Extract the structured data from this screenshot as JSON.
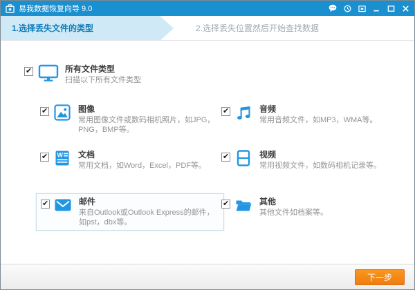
{
  "window": {
    "title": "易我数据恢复向导 9.0",
    "titlebar_icons": [
      "chat",
      "history",
      "window",
      "minimize",
      "maximize",
      "close"
    ]
  },
  "steps": [
    {
      "label": "1.选择丢失文件的类型",
      "active": true
    },
    {
      "label": "2.选择丢失位置然后开始查找数据",
      "active": false
    }
  ],
  "all_types": {
    "title": "所有文件类型",
    "desc": "扫描以下所有文件类型",
    "checked": true
  },
  "filetypes": {
    "items": [
      {
        "title": "图像",
        "desc": "常用图像文件或数码相机照片，如JPG，PNG，BMP等。",
        "checked": true,
        "icon": "image-icon",
        "highlighted": false
      },
      {
        "title": "音频",
        "desc": "常用音频文件，如MP3，WMA等。",
        "checked": true,
        "icon": "audio-icon",
        "highlighted": false
      },
      {
        "title": "文档",
        "desc": "常用文档，如Word，Excel，PDF等。",
        "checked": true,
        "icon": "document-icon",
        "highlighted": false
      },
      {
        "title": "视频",
        "desc": "常用视频文件，如数码相机记录等。",
        "checked": true,
        "icon": "video-icon",
        "highlighted": false
      },
      {
        "title": "邮件",
        "desc": "来自Outlook或Outlook Express的邮件，如pst，dbx等。",
        "checked": true,
        "icon": "mail-icon",
        "highlighted": true
      },
      {
        "title": "其他",
        "desc": "其他文件如档案等。",
        "checked": true,
        "icon": "folder-icon",
        "highlighted": false
      }
    ]
  },
  "footer": {
    "next_label": "下一步"
  },
  "colors": {
    "titlebar_blue": "#1a90d0",
    "step_active_bg": "#cfe9f6",
    "step_active_text": "#0e7cba",
    "icon_blue": "#2196e3",
    "button_orange": "#f5831f"
  }
}
